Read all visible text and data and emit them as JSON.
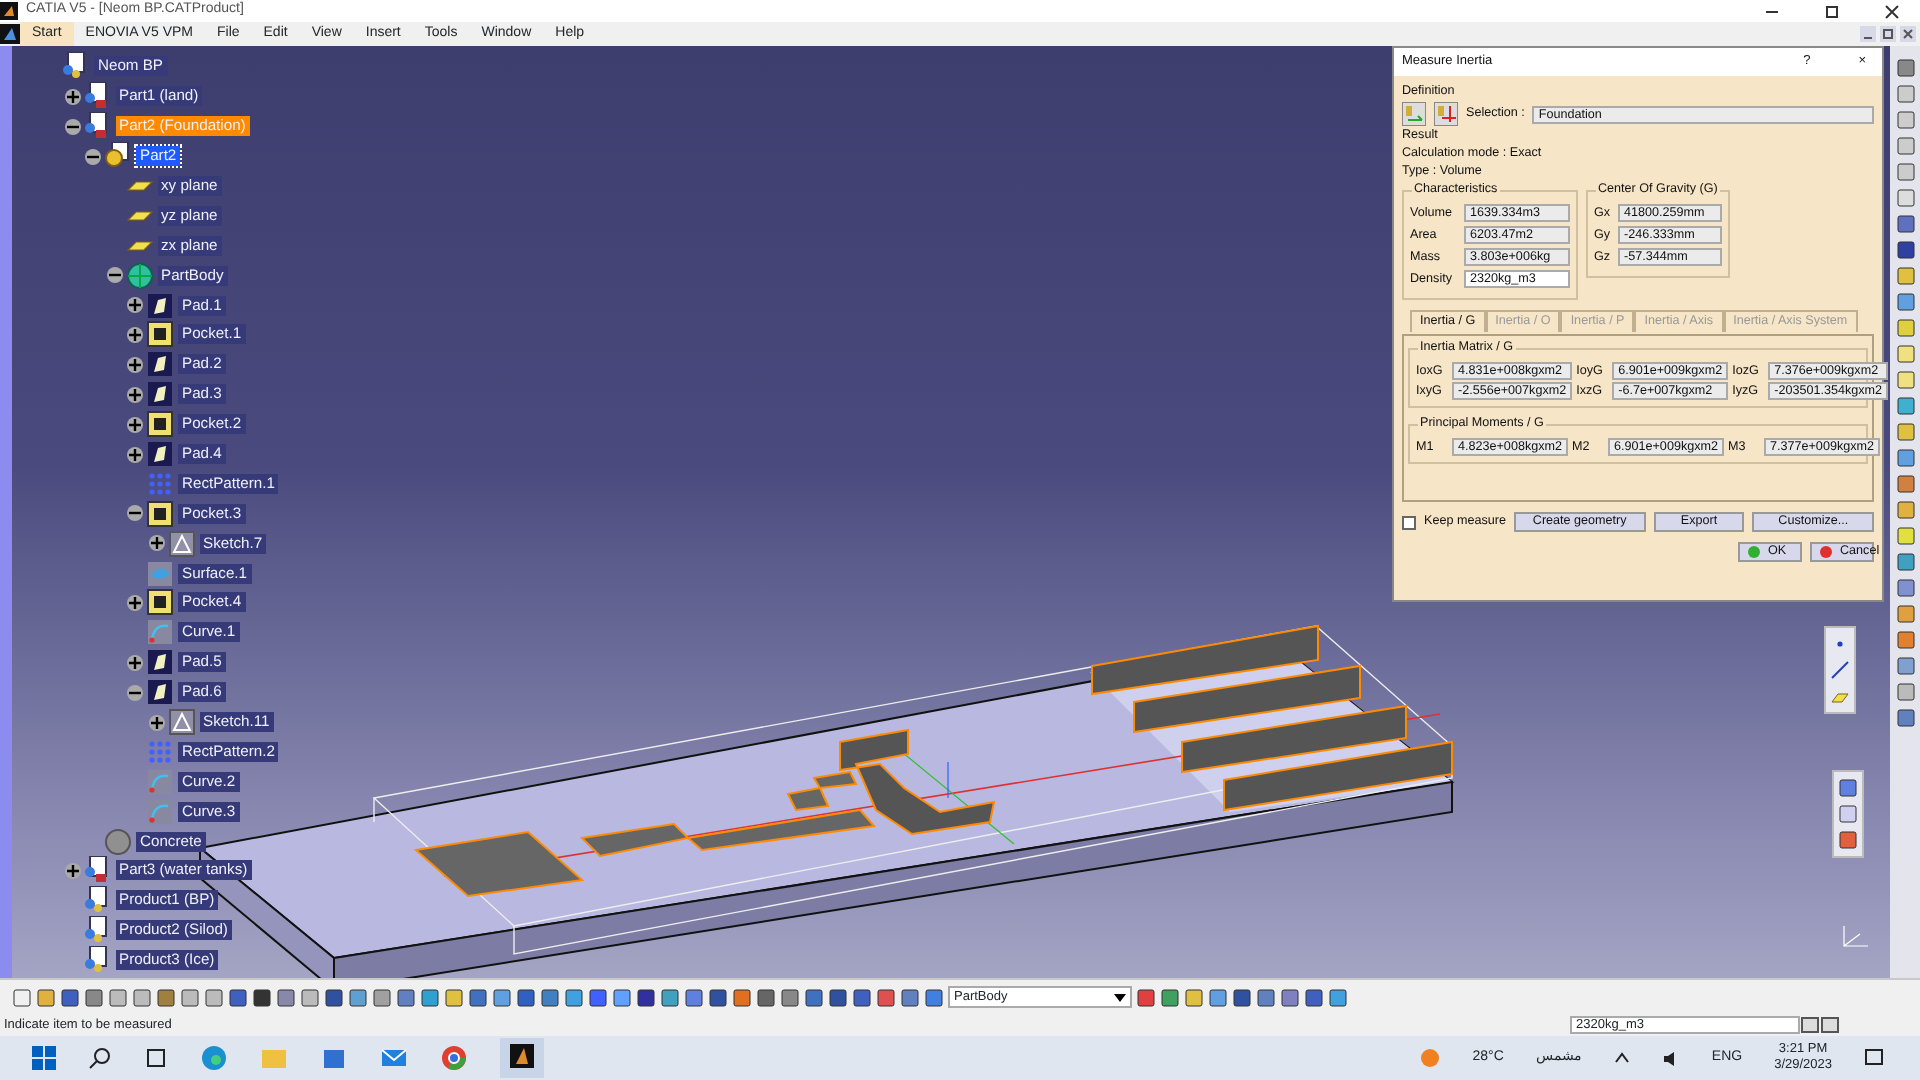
{
  "window": {
    "title": "CATIA V5 - [Neom BP.CATProduct]"
  },
  "menu": [
    {
      "label": "Start",
      "selected": true
    },
    {
      "label": "ENOVIA V5 VPM",
      "selected": false
    },
    {
      "label": "File",
      "selected": false
    },
    {
      "label": "Edit",
      "selected": false
    },
    {
      "label": "View",
      "selected": false
    },
    {
      "label": "Insert",
      "selected": false
    },
    {
      "label": "Tools",
      "selected": false
    },
    {
      "label": "Window",
      "selected": false
    },
    {
      "label": "Help",
      "selected": false
    }
  ],
  "tree": [
    {
      "label": "Neom BP",
      "kind": "product",
      "selected": false,
      "highlighted": false,
      "children": [
        {
          "label": "Part1 (land)",
          "kind": "part",
          "selected": false,
          "highlighted": false,
          "expanded": false
        },
        {
          "label": "Part2 (Foundation)",
          "kind": "part",
          "selected": false,
          "highlighted": true,
          "expanded": true,
          "children": [
            {
              "label": "Part2",
              "kind": "partdef",
              "selected": true,
              "highlighted": false,
              "expanded": true,
              "children": [
                {
                  "label": "xy plane",
                  "kind": "plane",
                  "selected": false,
                  "highlighted": false
                },
                {
                  "label": "yz plane",
                  "kind": "plane",
                  "selected": false,
                  "highlighted": false
                },
                {
                  "label": "zx plane",
                  "kind": "plane",
                  "selected": false,
                  "highlighted": false
                },
                {
                  "label": "PartBody",
                  "kind": "body",
                  "selected": false,
                  "highlighted": false,
                  "expanded": true,
                  "children": [
                    {
                      "label": "Pad.1",
                      "kind": "pad",
                      "selected": false,
                      "highlighted": false,
                      "expanded": false
                    },
                    {
                      "label": "Pocket.1",
                      "kind": "pocket",
                      "selected": false,
                      "highlighted": false,
                      "expanded": false
                    },
                    {
                      "label": "Pad.2",
                      "kind": "pad",
                      "selected": false,
                      "highlighted": false,
                      "expanded": false
                    },
                    {
                      "label": "Pad.3",
                      "kind": "pad",
                      "selected": false,
                      "highlighted": false,
                      "expanded": false
                    },
                    {
                      "label": "Pocket.2",
                      "kind": "pocket",
                      "selected": false,
                      "highlighted": false,
                      "expanded": false
                    },
                    {
                      "label": "Pad.4",
                      "kind": "pad",
                      "selected": false,
                      "highlighted": false,
                      "expanded": false
                    },
                    {
                      "label": "RectPattern.1",
                      "kind": "pattern",
                      "selected": false,
                      "highlighted": false
                    },
                    {
                      "label": "Pocket.3",
                      "kind": "pocket",
                      "selected": false,
                      "highlighted": false,
                      "expanded": true,
                      "children": [
                        {
                          "label": "Sketch.7",
                          "kind": "sketch",
                          "selected": false,
                          "highlighted": false,
                          "expanded": false
                        }
                      ]
                    },
                    {
                      "label": "Surface.1",
                      "kind": "surface",
                      "selected": false,
                      "highlighted": false
                    },
                    {
                      "label": "Pocket.4",
                      "kind": "pocket",
                      "selected": false,
                      "highlighted": false,
                      "expanded": false
                    },
                    {
                      "label": "Curve.1",
                      "kind": "curve",
                      "selected": false,
                      "highlighted": false
                    },
                    {
                      "label": "Pad.5",
                      "kind": "pad",
                      "selected": false,
                      "highlighted": false,
                      "expanded": false
                    },
                    {
                      "label": "Pad.6",
                      "kind": "pad",
                      "selected": false,
                      "highlighted": false,
                      "expanded": true,
                      "children": [
                        {
                          "label": "Sketch.11",
                          "kind": "sketch",
                          "selected": false,
                          "highlighted": false,
                          "expanded": false
                        }
                      ]
                    },
                    {
                      "label": "RectPattern.2",
                      "kind": "pattern",
                      "selected": false,
                      "highlighted": false
                    },
                    {
                      "label": "Curve.2",
                      "kind": "curve",
                      "selected": false,
                      "highlighted": false
                    },
                    {
                      "label": "Curve.3",
                      "kind": "curve",
                      "selected": false,
                      "highlighted": false
                    }
                  ]
                }
              ]
            },
            {
              "label": "Concrete",
              "kind": "material",
              "selected": false,
              "highlighted": false
            }
          ]
        },
        {
          "label": "Part3 (water tanks)",
          "kind": "part",
          "selected": false,
          "highlighted": false,
          "expanded": false
        },
        {
          "label": "Product1 (BP)",
          "kind": "product",
          "selected": false,
          "highlighted": false
        },
        {
          "label": "Product2 (Silod)",
          "kind": "product",
          "selected": false,
          "highlighted": false
        },
        {
          "label": "Product3 (Ice)",
          "kind": "product",
          "selected": false,
          "highlighted": false
        }
      ]
    }
  ],
  "dialog": {
    "title": "Measure Inertia",
    "help_button": "?",
    "close_button": "×",
    "definition": {
      "label": "Definition",
      "selection_label": "Selection :",
      "selection": "Foundation"
    },
    "result": {
      "label": "Result",
      "calculation_mode": "Calculation mode :  Exact",
      "type": "Type :  Volume"
    },
    "characteristics": {
      "label": "Characteristics",
      "fields": [
        {
          "label": "Volume",
          "value": "1639.334m3",
          "editable": false
        },
        {
          "label": "Area",
          "value": "6203.47m2",
          "editable": false
        },
        {
          "label": "Mass",
          "value": "3.803e+006kg",
          "editable": false
        },
        {
          "label": "Density",
          "value": "2320kg_m3",
          "editable": true
        }
      ]
    },
    "center_of_gravity": {
      "label": "Center Of Gravity (G)",
      "fields": [
        {
          "label": "Gx",
          "value": "41800.259mm"
        },
        {
          "label": "Gy",
          "value": "-246.333mm"
        },
        {
          "label": "Gz",
          "value": "-57.344mm"
        }
      ]
    },
    "tabs": [
      {
        "label": "Inertia / G",
        "selected": true
      },
      {
        "label": "Inertia / O",
        "selected": false
      },
      {
        "label": "Inertia / P",
        "selected": false
      },
      {
        "label": "Inertia / Axis",
        "selected": false
      },
      {
        "label": "Inertia / Axis System",
        "selected": false
      }
    ],
    "inertia_matrix": {
      "label": "Inertia Matrix / G",
      "fields": [
        {
          "label": "IoxG",
          "value": "4.831e+008kgxm2"
        },
        {
          "label": "IoyG",
          "value": "6.901e+009kgxm2"
        },
        {
          "label": "IozG",
          "value": "7.376e+009kgxm2"
        },
        {
          "label": "IxyG",
          "value": "-2.556e+007kgxm2"
        },
        {
          "label": "IxzG",
          "value": "-6.7e+007kgxm2"
        },
        {
          "label": "IyzG",
          "value": "-203501.354kgxm2"
        }
      ]
    },
    "principal_moments": {
      "label": "Principal Moments / G",
      "fields": [
        {
          "label": "M1",
          "value": "4.823e+008kgxm2"
        },
        {
          "label": "M2",
          "value": "6.901e+009kgxm2"
        },
        {
          "label": "M3",
          "value": "7.377e+009kgxm2"
        }
      ]
    },
    "keep_measure": {
      "label": "Keep measure",
      "checked": false
    },
    "buttons": [
      "Create geometry",
      "Export",
      "Customize..."
    ],
    "actions": [
      {
        "label": "OK",
        "kind": "ok"
      },
      {
        "label": "Cancel",
        "kind": "cancel"
      }
    ]
  },
  "toolbar": {
    "body_dropdown": "PartBody"
  },
  "status_bar": {
    "message": "Indicate item to be measured",
    "value": "2320kg_m3"
  },
  "taskbar": {
    "temperature": "28°C",
    "weather": "مشمس",
    "language": "ENG",
    "time": "3:21 PM",
    "date": "3/29/2023"
  }
}
